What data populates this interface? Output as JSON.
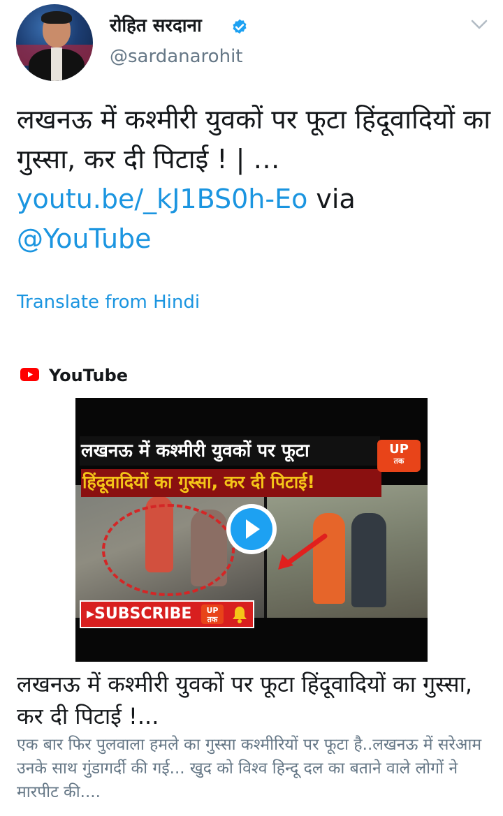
{
  "author": {
    "display_name": "रोहित सरदाना",
    "handle": "@sardanarohit",
    "verified": true
  },
  "tweet": {
    "text_prefix": "लखनऊ में कश्मीरी युवकों पर फूटा हिंदूवादियों का गुस्सा, कर दी पिटाई ! | … ",
    "link": "youtu.be/_kJ1BS0h-Eo",
    "text_mid": " via ",
    "mention": "@YouTube",
    "translate_label": "Translate from Hindi"
  },
  "card": {
    "source_label": "YouTube",
    "thumbnail": {
      "headline_line1": "लखनऊ में कश्मीरी युवकों पर फूटा",
      "headline_line2": "हिंदूवादियों का गुस्सा, कर दी पिटाई!",
      "badge_main": "UP",
      "badge_sub": "तक",
      "subscribe_label": "▸SUBSCRIBE"
    },
    "title": "लखनऊ में कश्मीरी युवकों पर फूटा हिंदूवादियों का गुस्सा, कर दी पिटाई !...",
    "description": "एक बार फिर पुलवाला हमले का गुस्सा कश्मीरियों पर फूटा है..लखनऊ में सरेआम उनके साथ गुंडागर्दी की गई... खुद को विश्व हिन्दू दल का बताने वाले लोगों ने मारपीट की...."
  },
  "colors": {
    "link_blue": "#1b95e0",
    "youtube_red": "#ff0000",
    "secondary_text": "#657786"
  },
  "icons": {
    "verified": "verified-badge-icon",
    "menu": "chevron-down-icon",
    "source": "youtube-logo-icon",
    "play": "play-button-icon"
  }
}
